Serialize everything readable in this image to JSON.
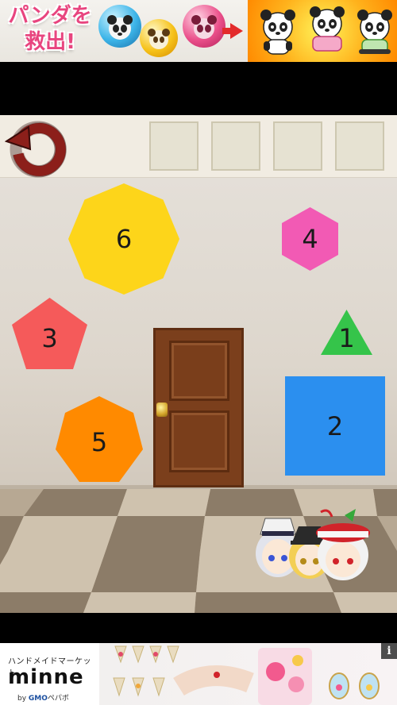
{
  "top_ad": {
    "headline_line1": "パンダを",
    "headline_line2": "救出!",
    "colors": {
      "pink": "#e8457f",
      "orange": "#ff9c00",
      "yellow": "#fff45a"
    }
  },
  "toolbar": {
    "reset_icon": "reset-arrow-icon",
    "reset_color": "#8c1f1a",
    "inventory_slots": 4
  },
  "shapes": [
    {
      "id": "shape-1",
      "label": "1",
      "shape": "triangle",
      "color": "#35c44a"
    },
    {
      "id": "shape-2",
      "label": "2",
      "shape": "square",
      "color": "#2b8fef"
    },
    {
      "id": "shape-3",
      "label": "3",
      "shape": "pentagon",
      "color": "#f55a5a"
    },
    {
      "id": "shape-4",
      "label": "4",
      "shape": "hexagon",
      "color": "#f25ab4"
    },
    {
      "id": "shape-5",
      "label": "5",
      "shape": "heptagon",
      "color": "#ff8a00"
    },
    {
      "id": "shape-6",
      "label": "6",
      "shape": "octagon",
      "color": "#fdd51a"
    }
  ],
  "door": {
    "color": "#7b3f1c",
    "knob_color": "#d4a52a"
  },
  "bottom_ad": {
    "small_text": "ハンドメイドマーケット",
    "brand": "minne",
    "by_text": "by",
    "company": "GMO",
    "company_suffix": "ペパボ",
    "info_label": "i"
  }
}
